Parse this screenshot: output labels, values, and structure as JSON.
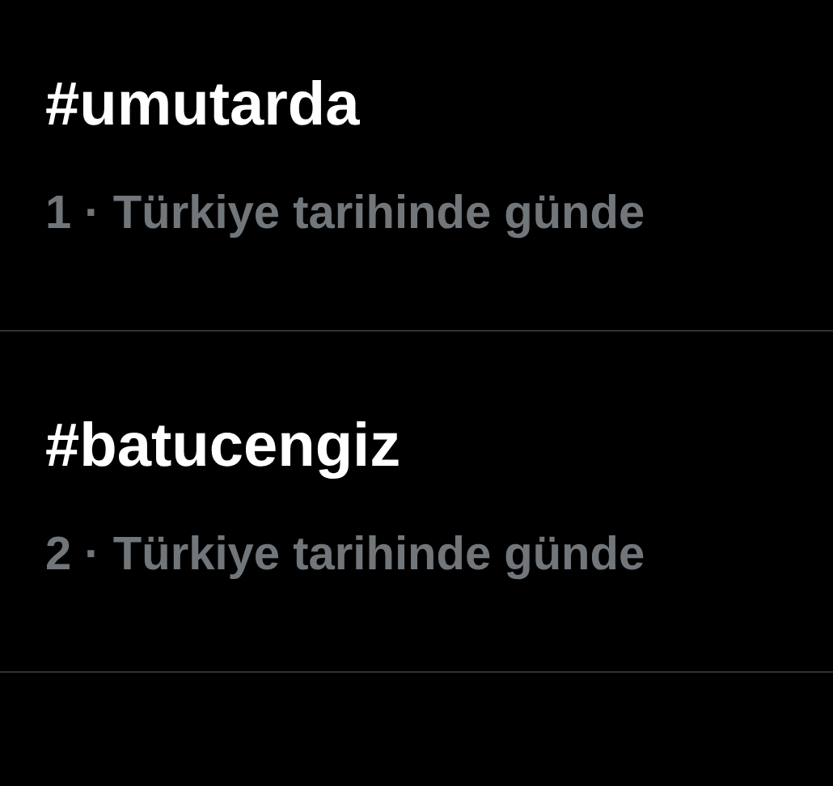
{
  "trends": [
    {
      "title": "#umutarda",
      "meta": "1 · Türkiye tarihinde günde"
    },
    {
      "title": "#batucengiz",
      "meta": "2 · Türkiye tarihinde günde"
    }
  ]
}
